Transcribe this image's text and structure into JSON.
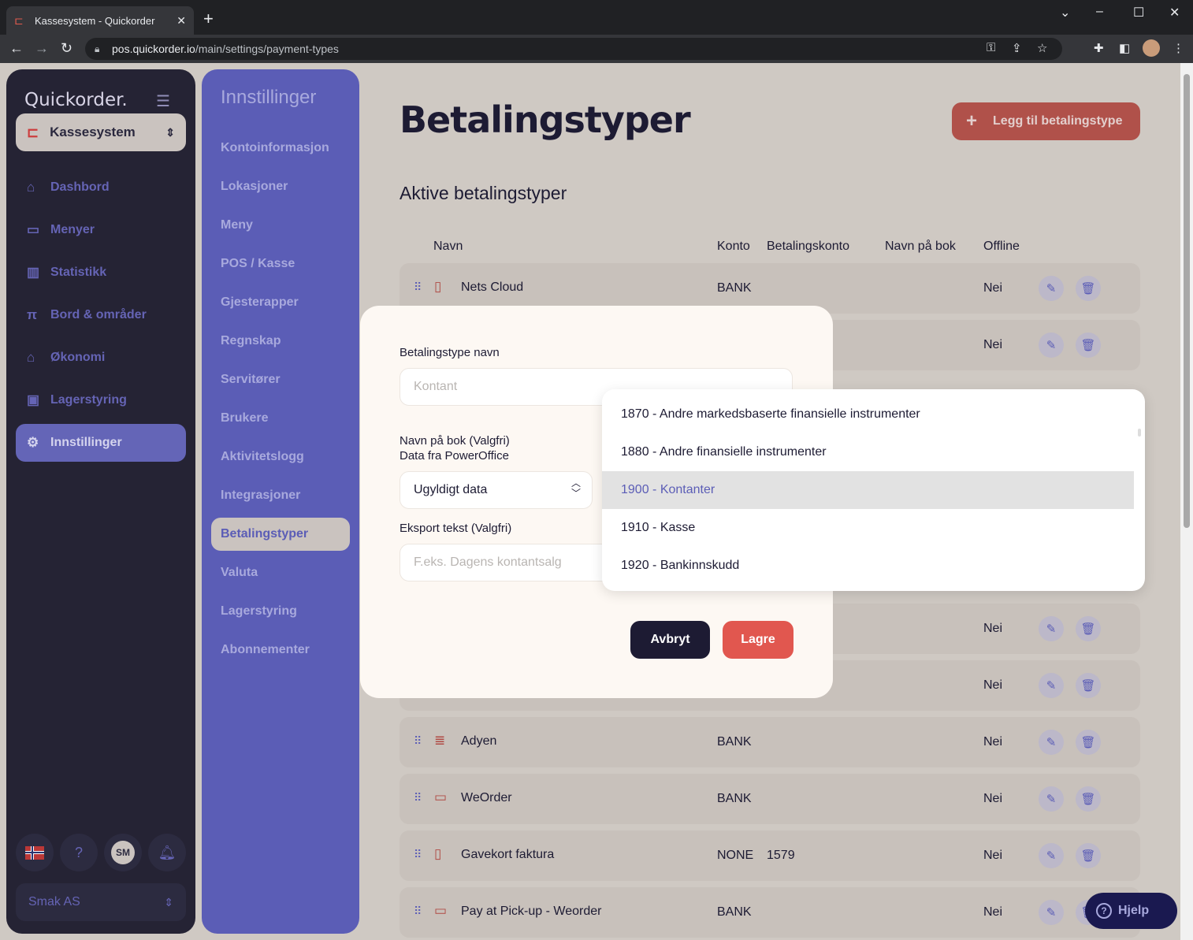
{
  "browser": {
    "tab_title": "Kassesystem - Quickorder",
    "url_host": "pos.quickorder.io",
    "url_path": "/main/settings/payment-types"
  },
  "leftnav": {
    "brand": "Quickorder.",
    "org": "Kassesystem",
    "items": [
      {
        "label": "Dashbord",
        "icon": "home-icon",
        "glyph": "⌂"
      },
      {
        "label": "Menyer",
        "icon": "book-icon",
        "glyph": "▭"
      },
      {
        "label": "Statistikk",
        "icon": "chart-icon",
        "glyph": "▥"
      },
      {
        "label": "Bord & områder",
        "icon": "table-icon",
        "glyph": "π"
      },
      {
        "label": "Økonomi",
        "icon": "bank-icon",
        "glyph": "⌂"
      },
      {
        "label": "Lagerstyring",
        "icon": "archive-icon",
        "glyph": "▣"
      },
      {
        "label": "Innstillinger",
        "icon": "gear-icon",
        "glyph": "⚙"
      }
    ],
    "avatar_initials": "SM",
    "company": "Smak AS"
  },
  "settingsnav": {
    "title": "Innstillinger",
    "items": [
      "Kontoinformasjon",
      "Lokasjoner",
      "Meny",
      "POS / Kasse",
      "Gjesterapper",
      "Regnskap",
      "Servitører",
      "Brukere",
      "Aktivitetslogg",
      "Integrasjoner",
      "Betalingstyper",
      "Valuta",
      "Lagerstyring",
      "Abonnementer"
    ]
  },
  "main": {
    "title": "Betalingstyper",
    "add_button": "Legg til betalingstype",
    "section_title": "Aktive betalingstyper",
    "columns": [
      "Navn",
      "Konto",
      "Betalingskonto",
      "Navn på bok",
      "Offline"
    ],
    "rows": [
      {
        "name": "Nets Cloud",
        "konto": "BANK",
        "betalingskonto": "",
        "offline": "Nei",
        "icon": "mobile-icon"
      },
      {
        "name": "",
        "konto": "",
        "betalingskonto": "",
        "offline": "Nei",
        "icon": ""
      },
      {
        "name": "",
        "konto": "",
        "betalingskonto": "",
        "offline": "Nei",
        "icon": ""
      },
      {
        "name": "",
        "konto": "",
        "betalingskonto": "",
        "offline": "Nei",
        "icon": ""
      },
      {
        "name": "Adyen",
        "konto": "BANK",
        "betalingskonto": "",
        "offline": "Nei",
        "icon": "coins-icon"
      },
      {
        "name": "WeOrder",
        "konto": "BANK",
        "betalingskonto": "",
        "offline": "Nei",
        "icon": "card-icon"
      },
      {
        "name": "Gavekort faktura",
        "konto": "NONE",
        "betalingskonto": "1579",
        "offline": "Nei",
        "icon": "mobile-icon"
      },
      {
        "name": "Pay at Pick-up - Weorder",
        "konto": "BANK",
        "betalingskonto": "",
        "offline": "Nei",
        "icon": "card-icon"
      }
    ],
    "help": "Hjelp"
  },
  "modal": {
    "name_label": "Betalingstype navn",
    "name_placeholder": "Kontant",
    "book_label": "Navn på bok (Valgfri)",
    "book_sub": "Data fra PowerOffice",
    "book_value": "Ugyldigt data",
    "export_label": "Eksport tekst (Valgfri)",
    "export_placeholder": "F.eks. Dagens kontantsalg",
    "cancel": "Avbryt",
    "save": "Lagre"
  },
  "dropdown": {
    "options": [
      "1870 - Andre markedsbaserte finansielle instrumenter",
      "1880 - Andre finansielle instrumenter",
      "1900 - Kontanter",
      "1910 - Kasse",
      "1920 - Bankinnskudd"
    ],
    "selected": "1900 - Kontanter"
  }
}
